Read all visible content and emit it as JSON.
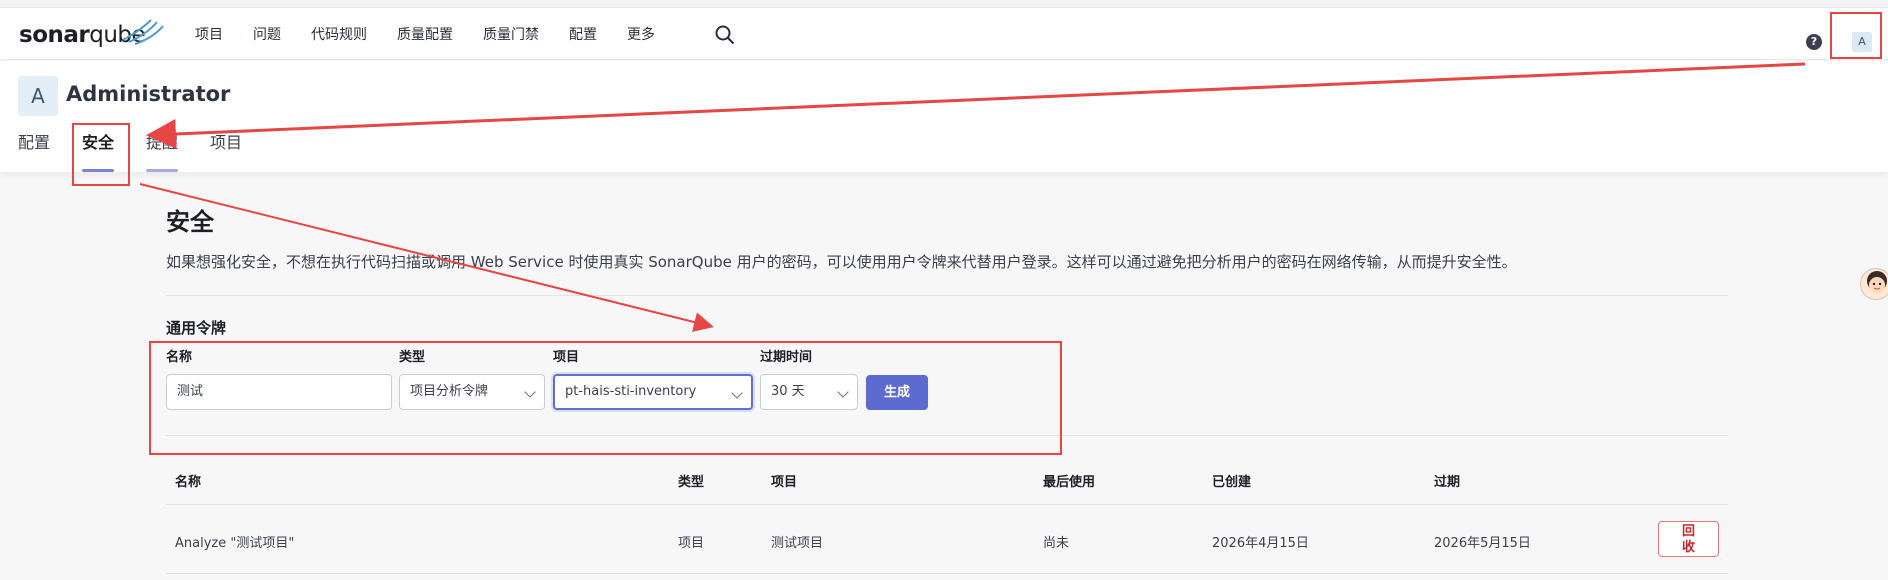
{
  "brand": {
    "name_bold": "sonar",
    "name_light": "qube"
  },
  "nav": {
    "items": [
      "项目",
      "问题",
      "代码规则",
      "质量配置",
      "质量门禁",
      "配置",
      "更多"
    ],
    "help": "?",
    "avatar_letter": "A"
  },
  "user": {
    "avatar_letter": "A",
    "name": "Administrator"
  },
  "tabs": [
    "配置",
    "安全",
    "提醒",
    "项目"
  ],
  "active_tab": "安全",
  "security": {
    "title": "安全",
    "description": "如果想强化安全，不想在执行代码扫描或调用 Web Service 时使用真实 SonarQube 用户的密码，可以使用用户令牌来代替用户登录。这样可以通过避免把分析用户的密码在网络传输，从而提升安全性。",
    "section_title": "通用令牌",
    "form": {
      "name_label": "名称",
      "name_value": "测试",
      "type_label": "类型",
      "type_value": "项目分析令牌",
      "project_label": "项目",
      "project_value": "pt-hais-sti-inventory",
      "expiry_label": "过期时间",
      "expiry_value": "30 天",
      "generate_label": "生成"
    },
    "table": {
      "headers": [
        "名称",
        "类型",
        "项目",
        "最后使用",
        "已创建",
        "过期"
      ],
      "rows": [
        {
          "name": "Analyze \"测试项目\"",
          "type": "项目",
          "project": "测试项目",
          "last_used": "尚未",
          "created": "2026年4月15日",
          "expires": "2026年5月15日",
          "revoke_line1": "回",
          "revoke_line2": "收"
        }
      ]
    }
  },
  "colors": {
    "accent": "#5d6bd0",
    "annotation": "#e84545",
    "danger": "#c62828"
  }
}
